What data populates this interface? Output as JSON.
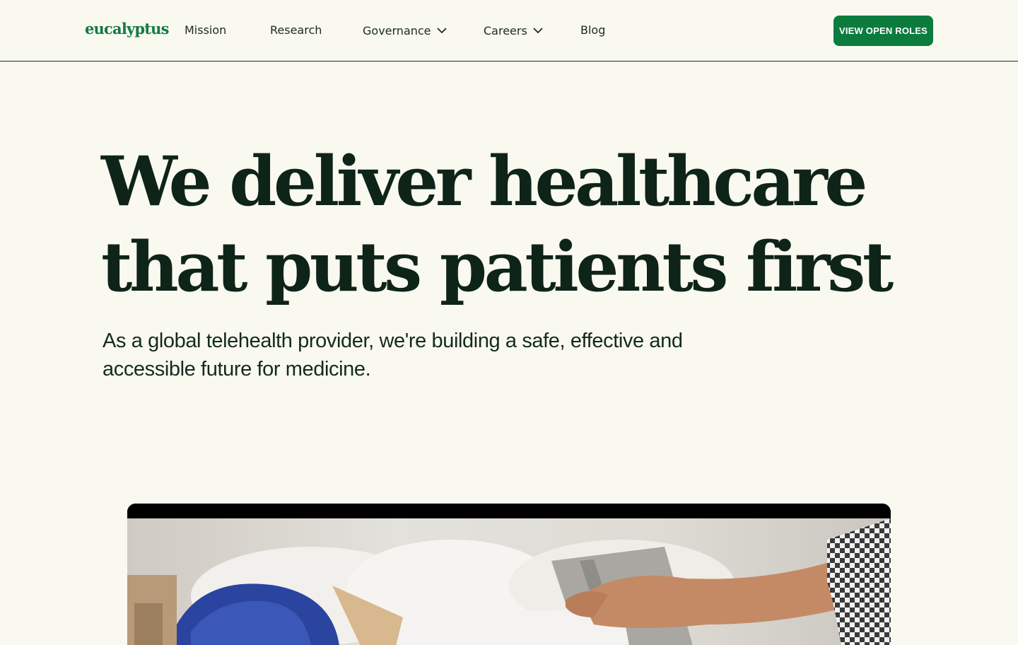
{
  "header": {
    "logo": "eucalyptus",
    "nav": [
      {
        "label": "Mission"
      },
      {
        "label": "Research"
      },
      {
        "label": "Governance",
        "has_dropdown": true
      },
      {
        "label": "Careers",
        "has_dropdown": true
      },
      {
        "label": "Blog"
      }
    ],
    "cta_label": "VIEW OPEN ROLES"
  },
  "hero": {
    "title_line1": "We deliver healthcare",
    "title_line2": "that puts patients first",
    "subtitle": "As a global telehealth provider, we're building a safe, effective and accessible future for medicine."
  },
  "colors": {
    "background": "#f9f9f0",
    "brand_green": "#0b7b3e",
    "text_dark": "#0f2419"
  },
  "icons": {
    "dropdown": "chevron-down-icon"
  }
}
